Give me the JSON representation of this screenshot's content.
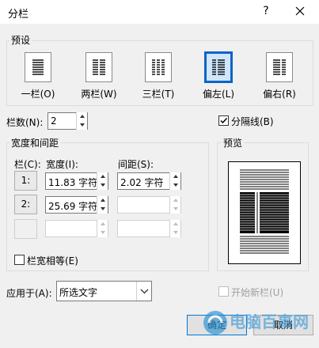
{
  "dialog": {
    "title": "分栏",
    "help": "?"
  },
  "presets": {
    "group_label": "预设",
    "items": [
      {
        "label": "一栏(O)",
        "icon": "one-column-icon",
        "selected": false
      },
      {
        "label": "两栏(W)",
        "icon": "two-column-icon",
        "selected": false
      },
      {
        "label": "三栏(T)",
        "icon": "three-column-icon",
        "selected": false
      },
      {
        "label": "偏左(L)",
        "icon": "left-column-icon",
        "selected": true
      },
      {
        "label": "偏右(R)",
        "icon": "right-column-icon",
        "selected": false
      }
    ]
  },
  "num_columns": {
    "label": "栏数(N):",
    "value": "2"
  },
  "separator": {
    "label": "分隔线(B)",
    "checked": true
  },
  "width_spacing": {
    "group_label": "宽度和间距",
    "col_header": "栏(C):",
    "width_header": "宽度(I):",
    "spacing_header": "间距(S):",
    "rows": [
      {
        "col": "1:",
        "width": "11.83 字符",
        "spacing": "2.02 字符"
      },
      {
        "col": "2:",
        "width": "25.69 字符",
        "spacing": ""
      },
      {
        "col": "",
        "width": "",
        "spacing": ""
      }
    ],
    "equal_width": {
      "label": "栏宽相等(E)",
      "checked": false
    }
  },
  "preview": {
    "group_label": "预览"
  },
  "apply_to": {
    "label": "应用于(A):",
    "value": "所选文字"
  },
  "new_column": {
    "label": "开始新栏(U)",
    "checked": false,
    "disabled": true
  },
  "buttons": {
    "ok": "确定",
    "cancel": "取消"
  },
  "watermark": {
    "text": "电脑百事网"
  },
  "colors": {
    "accent": "#0078d7",
    "selected_tile": "#cfe6fb"
  }
}
